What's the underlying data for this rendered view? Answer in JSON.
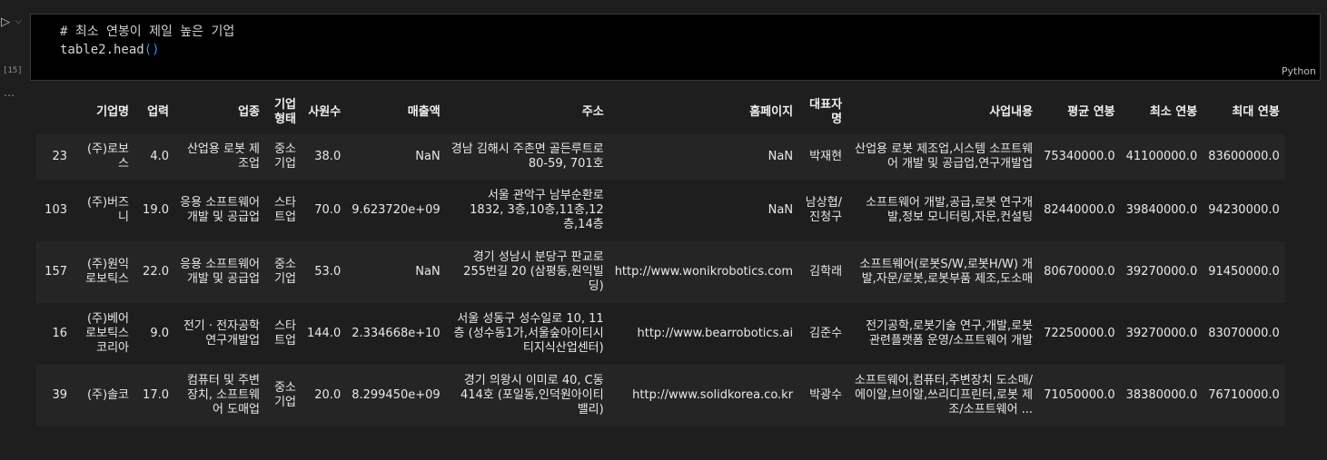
{
  "cell": {
    "exec_count": "[15]",
    "run_icon": "play-icon",
    "code_comment": "# 최소 연봉이 제일 높은 기업",
    "code_call": "table2.head",
    "code_open": "(",
    "code_close": ")",
    "language": "Python",
    "more": "⋯"
  },
  "table": {
    "columns": [
      "",
      "기업명",
      "업력",
      "업종",
      "기업형태",
      "사원수",
      "매출액",
      "주소",
      "홈페이지",
      "대표자명",
      "사업내용",
      "평균 연봉",
      "최소 연봉",
      "최대 연봉"
    ],
    "rows": [
      [
        "23",
        "(주)로보스",
        "4.0",
        "산업용 로봇 제조업",
        "중소기업",
        "38.0",
        "NaN",
        "경남 김해시 주촌면 골든루트로 80-59, 701호",
        "NaN",
        "박재현",
        "산업용 로봇 제조업,시스템 소프트웨어 개발 및 공급업,연구개발업",
        "75340000.0",
        "41100000.0",
        "83600000.0"
      ],
      [
        "103",
        "(주)버즈니",
        "19.0",
        "응용 소프트웨어 개발 및 공급업",
        "스타트업",
        "70.0",
        "9.623720e+09",
        "서울 관악구 남부순환로 1832, 3층,10층,11층,12층,14층",
        "NaN",
        "남상협/진청구",
        "소프트웨어 개발,공급,로봇 연구개발,정보 모니터링,자문,컨설팅",
        "82440000.0",
        "39840000.0",
        "94230000.0"
      ],
      [
        "157",
        "(주)원익로보틱스",
        "22.0",
        "응용 소프트웨어 개발 및 공급업",
        "중소기업",
        "53.0",
        "NaN",
        "경기 성남시 분당구 판교로255번길 20 (삼평동,원익빌딩)",
        "http://www.wonikrobotics.com",
        "김학래",
        "소프트웨어(로봇S/W,로봇H/W) 개발,자문/로봇,로봇부품 제조,도소매",
        "80670000.0",
        "39270000.0",
        "91450000.0"
      ],
      [
        "16",
        "(주)베어로보틱스코리아",
        "9.0",
        "전기 · 전자공학 연구개발업",
        "스타트업",
        "144.0",
        "2.334668e+10",
        "서울 성동구 성수일로 10, 11층 (성수동1가,서울숲아이티시티지식산업센터)",
        "http://www.bearrobotics.ai",
        "김준수",
        "전기공학,로봇기술 연구,개발,로봇 관련플랫폼 운영/소프트웨어 개발",
        "72250000.0",
        "39270000.0",
        "83070000.0"
      ],
      [
        "39",
        "(주)솔코",
        "17.0",
        "컴퓨터 및 주변장치, 소프트웨어 도매업",
        "중소기업",
        "20.0",
        "8.299450e+09",
        "경기 의왕시 이미로 40, C동 414호 (포일동,인덕원아이티밸리)",
        "http://www.solidkorea.co.kr",
        "박광수",
        "소프트웨어,컴퓨터,주변장치 도소매/에이알,브이알,쓰리디프린터,로봇 제조/소프트웨어 ...",
        "71050000.0",
        "38380000.0",
        "76710000.0"
      ]
    ]
  }
}
